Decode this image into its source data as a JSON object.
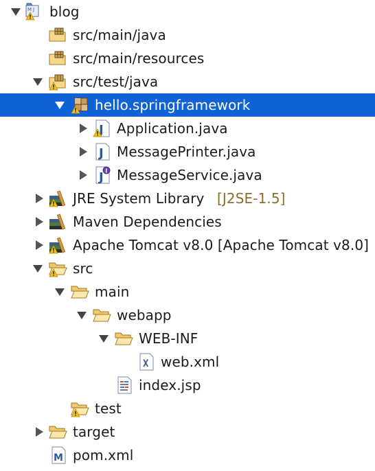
{
  "tree": {
    "nodes": [
      {
        "label": "blog",
        "decoration": "",
        "icon": "maven-project-warning-icon",
        "expander": "expanded",
        "selected": false
      },
      {
        "label": "src/main/java",
        "decoration": "",
        "icon": "source-folder-icon",
        "expander": "none",
        "selected": false
      },
      {
        "label": "src/main/resources",
        "decoration": "",
        "icon": "source-folder-icon",
        "expander": "none",
        "selected": false
      },
      {
        "label": "src/test/java",
        "decoration": "",
        "icon": "source-folder-warning-icon",
        "expander": "expanded",
        "selected": false
      },
      {
        "label": "hello.springframework",
        "decoration": "",
        "icon": "package-warning-icon",
        "expander": "expanded",
        "selected": true
      },
      {
        "label": "Application.java",
        "decoration": "",
        "icon": "java-class-warning-icon",
        "expander": "collapsed",
        "selected": false
      },
      {
        "label": "MessagePrinter.java",
        "decoration": "",
        "icon": "java-class-icon",
        "expander": "collapsed",
        "selected": false
      },
      {
        "label": "MessageService.java",
        "decoration": "",
        "icon": "java-interface-icon",
        "expander": "collapsed",
        "selected": false
      },
      {
        "label": "JRE System Library",
        "decoration": "[J2SE-1.5]",
        "icon": "library-warning-icon",
        "expander": "collapsed",
        "selected": false
      },
      {
        "label": "Maven Dependencies",
        "decoration": "",
        "icon": "library-icon",
        "expander": "collapsed",
        "selected": false
      },
      {
        "label": "Apache Tomcat v8.0 [Apache Tomcat v8.0]",
        "decoration": "",
        "icon": "library-warning-icon",
        "expander": "collapsed",
        "selected": false
      },
      {
        "label": "src",
        "decoration": "",
        "icon": "folder-open-warning-icon",
        "expander": "expanded",
        "selected": false
      },
      {
        "label": "main",
        "decoration": "",
        "icon": "folder-open-icon",
        "expander": "expanded",
        "selected": false
      },
      {
        "label": "webapp",
        "decoration": "",
        "icon": "folder-open-icon",
        "expander": "expanded",
        "selected": false
      },
      {
        "label": "WEB-INF",
        "decoration": "",
        "icon": "folder-open-icon",
        "expander": "expanded",
        "selected": false
      },
      {
        "label": "web.xml",
        "decoration": "",
        "icon": "xml-file-icon",
        "expander": "none",
        "selected": false
      },
      {
        "label": "index.jsp",
        "decoration": "",
        "icon": "jsp-file-icon",
        "expander": "none",
        "selected": false
      },
      {
        "label": "test",
        "decoration": "",
        "icon": "folder-open-warning-icon",
        "expander": "none",
        "selected": false
      },
      {
        "label": "target",
        "decoration": "",
        "icon": "folder-icon",
        "expander": "collapsed",
        "selected": false
      },
      {
        "label": "pom.xml",
        "decoration": "",
        "icon": "maven-pom-icon",
        "expander": "none",
        "selected": false
      }
    ]
  },
  "colors": {
    "selection": "#0f63d6",
    "selection_text": "#ffffff",
    "text": "#1a1a1a",
    "decoration": "#8a6d2b",
    "warning": "#f2c318"
  }
}
